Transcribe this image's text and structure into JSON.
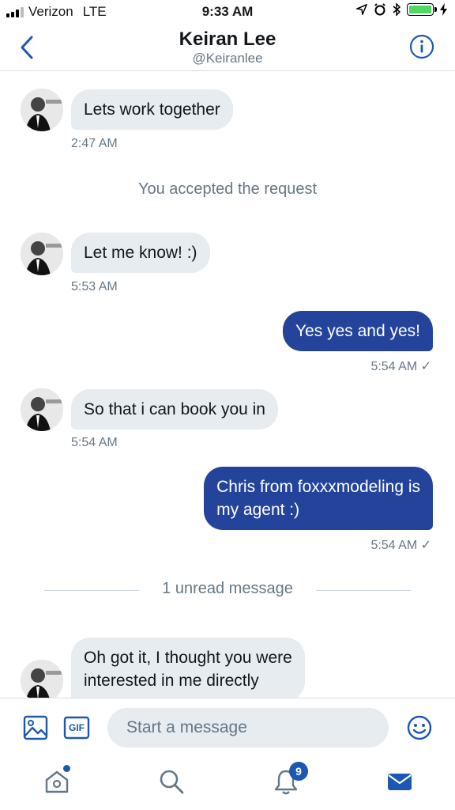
{
  "status_bar": {
    "carrier": "Verizon",
    "network": "LTE",
    "time": "9:33 AM"
  },
  "header": {
    "name": "Keiran Lee",
    "handle": "@Keiranlee",
    "back_icon": "chevron-left-icon",
    "info_icon": "info-icon"
  },
  "messages": [
    {
      "direction": "in",
      "text": "Lets work together",
      "time": "2:47 AM"
    },
    {
      "direction": "system",
      "text": "You accepted the request"
    },
    {
      "direction": "in",
      "text": "Let me know! :)",
      "time": "5:53 AM"
    },
    {
      "direction": "out",
      "text": "Yes yes and yes!",
      "time": "5:54 AM ✓"
    },
    {
      "direction": "in",
      "text": "So that i can book you in",
      "time": "5:54 AM"
    },
    {
      "direction": "out",
      "text_line1": "Chris from foxxxmodeling is",
      "text_line2": "my agent :)",
      "time": "5:54 AM ✓"
    },
    {
      "direction": "in",
      "text_line1": "Oh got it, I thought you were",
      "text_line2": "interested in me directly"
    }
  ],
  "unread_divider": "1 unread message",
  "composer": {
    "placeholder": "Start a message",
    "gif_label": "GIF",
    "image_icon": "image-icon",
    "emoji_icon": "emoji-icon"
  },
  "tabbar": {
    "notifications_badge": "9",
    "tabs": [
      "home-icon",
      "search-icon",
      "bell-icon",
      "mail-icon"
    ]
  },
  "colors": {
    "accent": "#1d58b0",
    "outgoing_bubble": "#24449c",
    "incoming_bubble": "#e6ecf0",
    "secondary_text": "#657786"
  }
}
